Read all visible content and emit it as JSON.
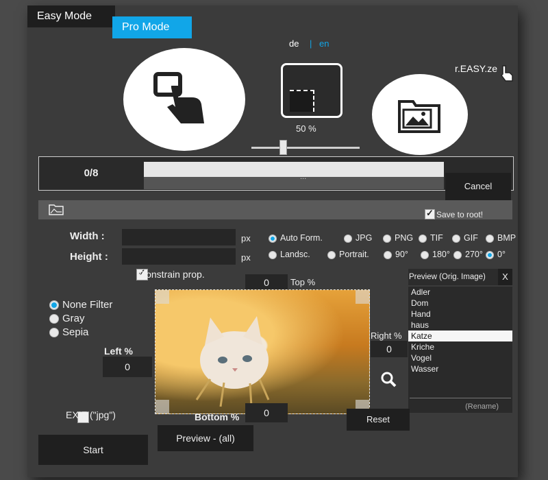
{
  "tabs": {
    "easy": "Easy Mode",
    "pro": "Pro Mode"
  },
  "language": {
    "de": "de",
    "sep": "|",
    "en": "en"
  },
  "brand": "r.EASY.ze",
  "zoom": {
    "label": "50 %",
    "value": 0.5
  },
  "progress": {
    "count": "0/8",
    "dots": "...",
    "cancel": "Cancel",
    "fraction": 0
  },
  "toolbar": {
    "save_to_root": "Save to root!",
    "save_checked": true
  },
  "size": {
    "width_label": "Width :",
    "height_label": "Height :",
    "unit": "px",
    "width_value": "",
    "height_value": ""
  },
  "formats": {
    "row1": [
      "Auto Form.",
      "JPG",
      "PNG",
      "TIF",
      "GIF",
      "BMP"
    ],
    "row1_selected": 0,
    "row2": [
      "Landsc.",
      "Portrait.",
      "90°",
      "180°",
      "270°",
      "0°"
    ],
    "row2_selected": 5
  },
  "constrain": {
    "label": "Constrain prop.",
    "checked": true
  },
  "filters": {
    "items": [
      "None Filter",
      "Gray",
      "Sepia"
    ],
    "selected": 0
  },
  "crop": {
    "top_label": "Top %",
    "top_value": "0",
    "left_label": "Left %",
    "left_value": "0",
    "right_label": "Right %",
    "right_value": "0",
    "bottom_label": "Bottom %",
    "bottom_value": "0"
  },
  "preview": {
    "title": "Preview (Orig. Image)",
    "close": "X",
    "files": [
      "Adler",
      "Dom",
      "Hand",
      "haus",
      "Katze",
      "Kriche",
      "Vogel",
      "Wasser"
    ],
    "selected": 4,
    "rename": "(Rename)"
  },
  "exif": {
    "label": "EXIF (\"jpg\")",
    "checked": false
  },
  "buttons": {
    "start": "Start",
    "preview_all": "Preview - (all)",
    "reset": "Reset"
  }
}
